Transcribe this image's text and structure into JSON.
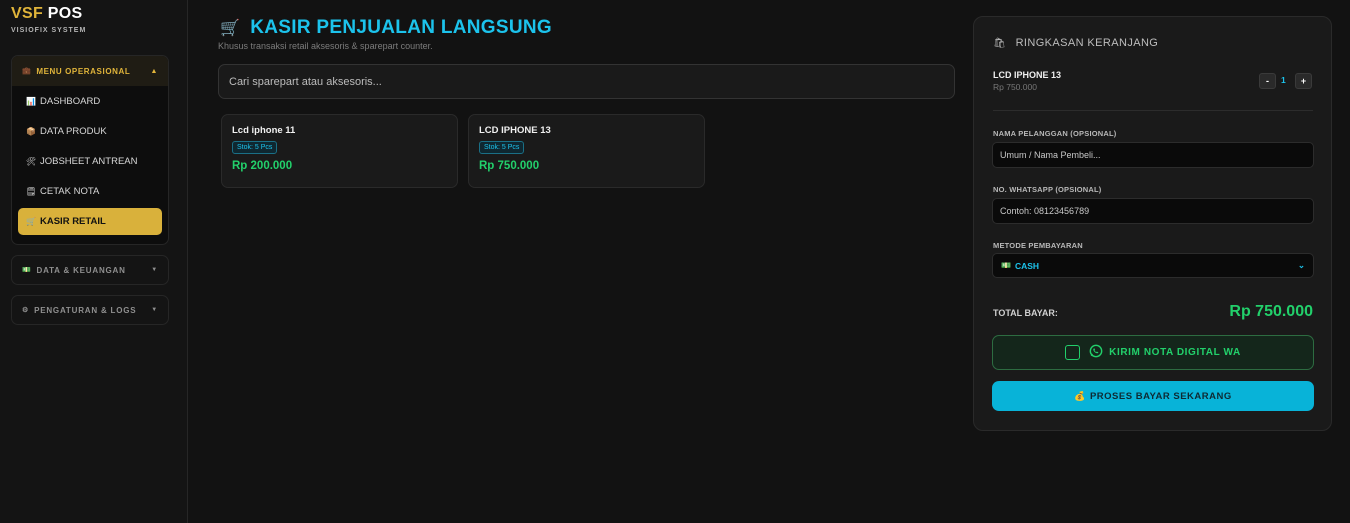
{
  "brand": {
    "part1": "VSF",
    "part2": "POS",
    "subtitle": "VISIOFIX SYSTEM"
  },
  "sidebar": {
    "operational": {
      "label": "MENU OPERASIONAL",
      "icon": "briefcase-icon",
      "items": [
        {
          "label": "DASHBOARD",
          "icon": "chart-icon"
        },
        {
          "label": "DATA PRODUK",
          "icon": "box-icon"
        },
        {
          "label": "JOBSHEET ANTREAN",
          "icon": "tools-icon"
        },
        {
          "label": "CETAK NOTA",
          "icon": "receipt-icon"
        },
        {
          "label": "KASIR RETAIL",
          "icon": "cart-icon",
          "active": true
        }
      ]
    },
    "finance": {
      "label": "DATA & KEUANGAN",
      "icon": "money-icon"
    },
    "settings": {
      "label": "PENGATURAN & LOGS",
      "icon": "gear-icon"
    }
  },
  "main": {
    "title": "KASIR PENJUALAN LANGSUNG",
    "subtitle": "Khusus transaksi retail aksesoris & sparepart counter.",
    "search_placeholder": "Cari sparepart atau aksesoris...",
    "products": [
      {
        "name": "Lcd iphone 11",
        "stock": "Stok: 5 Pcs",
        "price": "Rp 200.000"
      },
      {
        "name": "LCD IPHONE 13",
        "stock": "Stok: 5 Pcs",
        "price": "Rp 750.000"
      }
    ]
  },
  "cart": {
    "title": "RINGKASAN KERANJANG",
    "item": {
      "name": "LCD IPHONE 13",
      "price": "Rp 750.000",
      "qty": "1",
      "minus": "-",
      "plus": "+"
    },
    "customer_label": "NAMA PELANGGAN (OPSIONAL)",
    "customer_placeholder": "Umum / Nama Pembeli...",
    "whatsapp_label": "NO. WHATSAPP (OPSIONAL)",
    "whatsapp_placeholder": "Contoh: 08123456789",
    "payment_label": "METODE PEMBAYARAN",
    "payment_value": "CASH",
    "total_label": "TOTAL BAYAR:",
    "total_value": "Rp 750.000",
    "wa_button": "KIRIM NOTA DIGITAL WA",
    "pay_button": "PROSES BAYAR SEKARANG"
  },
  "colors": {
    "accent_gold": "#d9b13b",
    "accent_cyan": "#1cc3ec",
    "price_green": "#22d06b"
  }
}
